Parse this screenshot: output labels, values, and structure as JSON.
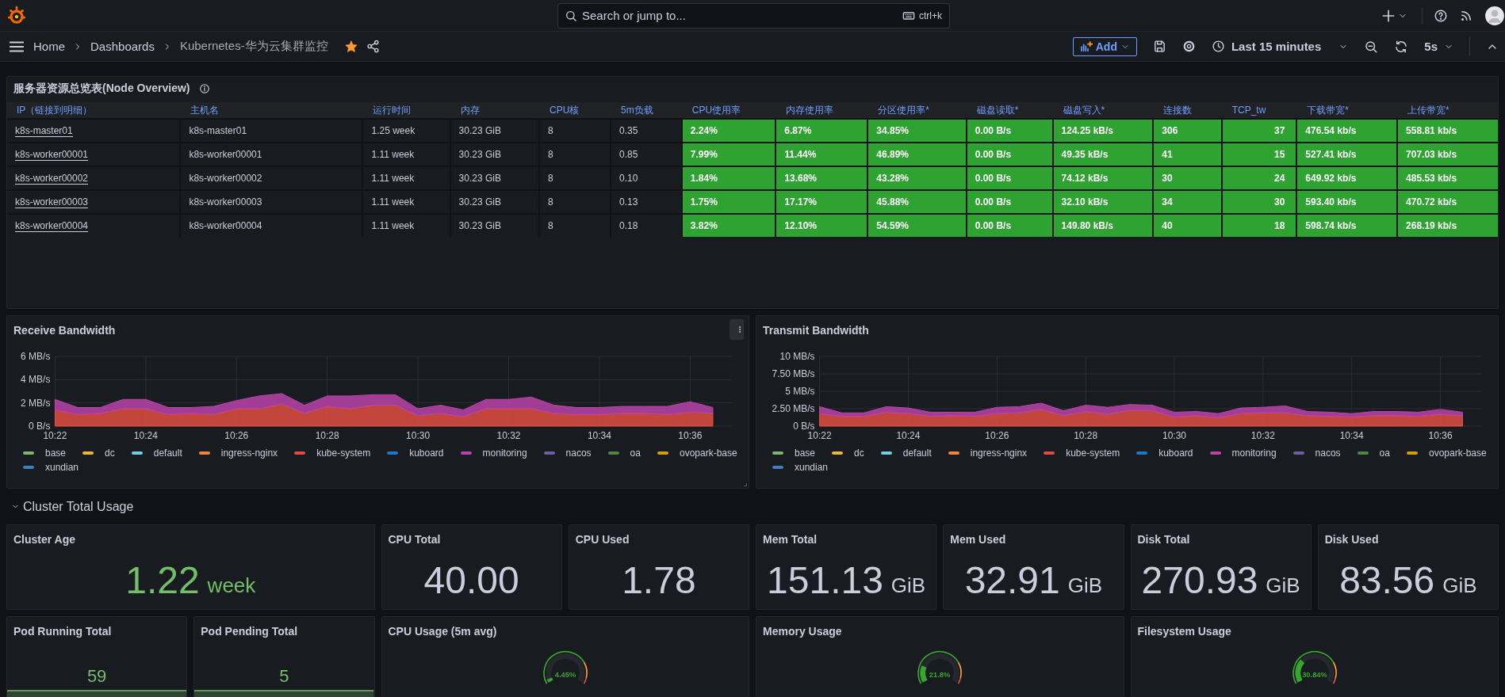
{
  "topbar": {
    "search": {
      "placeholder": "Search or jump to...",
      "shortcut": "ctrl+k"
    }
  },
  "navbar": {
    "breadcrumbs": [
      "Home",
      "Dashboards",
      "Kubernetes-华为云集群监控"
    ],
    "starred": true,
    "add_button": "Add",
    "time_range": "Last 15 minutes",
    "refresh_interval": "5s"
  },
  "table_panel": {
    "title": "服务器资源总览表(Node Overview)",
    "columns": [
      {
        "label": "IP（链接到明细）",
        "kind": "link"
      },
      {
        "label": "主机名",
        "kind": "text"
      },
      {
        "label": "运行时间",
        "kind": "text"
      },
      {
        "label": "内存",
        "kind": "text"
      },
      {
        "label": "CPU核",
        "kind": "text"
      },
      {
        "label": "5m负载",
        "kind": "text"
      },
      {
        "label": "CPU使用率",
        "kind": "colored"
      },
      {
        "label": "内存使用率",
        "kind": "colored"
      },
      {
        "label": "分区使用率*",
        "kind": "colored"
      },
      {
        "label": "磁盘读取*",
        "kind": "colored"
      },
      {
        "label": "磁盘写入*",
        "kind": "colored"
      },
      {
        "label": "连接数",
        "kind": "colored"
      },
      {
        "label": "TCP_tw",
        "kind": "colored-right"
      },
      {
        "label": "下载带宽*",
        "kind": "colored"
      },
      {
        "label": "上传带宽*",
        "kind": "colored"
      }
    ],
    "rows": [
      [
        "k8s-master01",
        "k8s-master01",
        "1.25 week",
        "30.23 GiB",
        "8",
        "0.35",
        "2.24%",
        "6.87%",
        "34.85%",
        "0.00 B/s",
        "124.25 kB/s",
        "306",
        "37",
        "476.54 kb/s",
        "558.81 kb/s"
      ],
      [
        "k8s-worker00001",
        "k8s-worker00001",
        "1.11 week",
        "30.23 GiB",
        "8",
        "0.85",
        "7.99%",
        "11.44%",
        "46.89%",
        "0.00 B/s",
        "49.35 kB/s",
        "41",
        "15",
        "527.41 kb/s",
        "707.03 kb/s"
      ],
      [
        "k8s-worker00002",
        "k8s-worker00002",
        "1.11 week",
        "30.23 GiB",
        "8",
        "0.10",
        "1.84%",
        "13.68%",
        "43.28%",
        "0.00 B/s",
        "74.12 kB/s",
        "30",
        "24",
        "649.92 kb/s",
        "485.53 kb/s"
      ],
      [
        "k8s-worker00003",
        "k8s-worker00003",
        "1.11 week",
        "30.23 GiB",
        "8",
        "0.13",
        "1.75%",
        "17.17%",
        "45.88%",
        "0.00 B/s",
        "32.10 kB/s",
        "34",
        "30",
        "593.40 kb/s",
        "470.72 kb/s"
      ],
      [
        "k8s-worker00004",
        "k8s-worker00004",
        "1.11 week",
        "30.23 GiB",
        "8",
        "0.18",
        "3.82%",
        "12.10%",
        "54.59%",
        "0.00 B/s",
        "149.80 kB/s",
        "40",
        "18",
        "598.74 kb/s",
        "268.19 kb/s"
      ]
    ]
  },
  "charts": [
    {
      "title": "Receive Bandwidth",
      "hovered": true,
      "chart_data": {
        "type": "area",
        "stacked": true,
        "grid": true,
        "categories": [
          "10:22",
          null,
          null,
          null,
          "10:24",
          null,
          null,
          null,
          "10:26",
          null,
          null,
          null,
          "10:28",
          null,
          null,
          null,
          "10:30",
          null,
          null,
          null,
          "10:32",
          null,
          null,
          null,
          "10:34",
          null,
          null,
          null,
          "10:36",
          null
        ],
        "ylim": [
          0,
          6
        ],
        "yticks": [
          {
            "value": 0,
            "label": "0 B/s"
          },
          {
            "value": 2,
            "label": "2 MB/s"
          },
          {
            "value": 4,
            "label": "4 MB/s"
          },
          {
            "value": 6,
            "label": "6 MB/s"
          }
        ],
        "series": [
          {
            "name": "kube-system",
            "color": "#e24d42",
            "values": [
              1.4,
              1.0,
              1.1,
              1.5,
              1.5,
              1.0,
              1.1,
              1.0,
              1.5,
              1.5,
              1.9,
              1.1,
              1.7,
              1.5,
              1.8,
              1.8,
              0.9,
              1.1,
              0.8,
              1.5,
              1.5,
              1.5,
              1.1,
              1.0,
              1.0,
              1.1,
              1.1,
              1.0,
              1.2,
              1.1
            ]
          },
          {
            "name": "monitoring",
            "color": "#ba43a9",
            "values": [
              0.9,
              0.6,
              0.5,
              0.8,
              0.8,
              0.6,
              0.5,
              0.7,
              0.7,
              1.1,
              0.9,
              0.7,
              0.9,
              1.1,
              0.9,
              0.9,
              0.6,
              0.7,
              0.6,
              0.8,
              0.8,
              1.0,
              0.7,
              0.6,
              0.6,
              0.6,
              0.6,
              0.7,
              0.9,
              0.5
            ]
          }
        ]
      },
      "legend": [
        {
          "kind": "flat",
          "name": "base",
          "color": "#7eb26d"
        },
        {
          "kind": "flat",
          "name": "dc",
          "color": "#eab839"
        },
        {
          "kind": "flat",
          "name": "default",
          "color": "#6ed0e0"
        },
        {
          "kind": "flat",
          "name": "ingress-nginx",
          "color": "#ef843c"
        },
        {
          "kind": "series"
        },
        {
          "kind": "flat",
          "name": "kuboard",
          "color": "#1f78c1"
        },
        {
          "kind": "series"
        },
        {
          "kind": "flat",
          "name": "nacos",
          "color": "#705da0"
        },
        {
          "kind": "flat",
          "name": "oa",
          "color": "#508642"
        },
        {
          "kind": "flat",
          "name": "ovopark-base",
          "color": "#cca300"
        },
        {
          "kind": "flat",
          "name": "xundian",
          "color": "#447ebc"
        }
      ]
    },
    {
      "title": "Transmit Bandwidth",
      "hovered": false,
      "chart_data": {
        "type": "area",
        "stacked": true,
        "grid": true,
        "categories": [
          "10:22",
          null,
          null,
          null,
          "10:24",
          null,
          null,
          null,
          "10:26",
          null,
          null,
          null,
          "10:28",
          null,
          null,
          null,
          "10:30",
          null,
          null,
          null,
          "10:32",
          null,
          null,
          null,
          "10:34",
          null,
          null,
          null,
          "10:36",
          null
        ],
        "ylim": [
          0,
          10
        ],
        "yticks": [
          {
            "value": 0,
            "label": "0 B/s"
          },
          {
            "value": 2.5,
            "label": "2.50 MB/s"
          },
          {
            "value": 5,
            "label": "5 MB/s"
          },
          {
            "value": 7.5,
            "label": "7.50 MB/s"
          },
          {
            "value": 10,
            "label": "10 MB/s"
          }
        ],
        "series": [
          {
            "name": "kube-system",
            "color": "#e24d42",
            "values": [
              1.8,
              1.4,
              1.4,
              2.0,
              1.8,
              1.4,
              1.5,
              1.4,
              1.8,
              1.9,
              2.4,
              1.5,
              2.1,
              1.7,
              2.3,
              2.2,
              1.3,
              1.5,
              1.2,
              1.8,
              1.9,
              1.9,
              1.5,
              1.4,
              1.3,
              1.5,
              1.5,
              1.4,
              1.7,
              1.5
            ]
          },
          {
            "name": "monitoring",
            "color": "#ba43a9",
            "values": [
              1.0,
              0.5,
              0.5,
              0.8,
              0.8,
              0.6,
              0.5,
              0.6,
              0.9,
              0.9,
              0.9,
              0.7,
              0.9,
              1.0,
              0.8,
              0.8,
              0.7,
              0.6,
              0.6,
              0.8,
              0.8,
              1.0,
              0.6,
              0.6,
              0.5,
              0.6,
              0.6,
              0.6,
              0.7,
              0.5
            ]
          }
        ]
      },
      "legend": [
        {
          "kind": "flat",
          "name": "base",
          "color": "#7eb26d"
        },
        {
          "kind": "flat",
          "name": "dc",
          "color": "#eab839"
        },
        {
          "kind": "flat",
          "name": "default",
          "color": "#6ed0e0"
        },
        {
          "kind": "flat",
          "name": "ingress-nginx",
          "color": "#ef843c"
        },
        {
          "kind": "series"
        },
        {
          "kind": "flat",
          "name": "kuboard",
          "color": "#1f78c1"
        },
        {
          "kind": "series"
        },
        {
          "kind": "flat",
          "name": "nacos",
          "color": "#705da0"
        },
        {
          "kind": "flat",
          "name": "oa",
          "color": "#508642"
        },
        {
          "kind": "flat",
          "name": "ovopark-base",
          "color": "#cca300"
        },
        {
          "kind": "flat",
          "name": "xundian",
          "color": "#447ebc"
        }
      ]
    }
  ],
  "row_header": {
    "title": "Cluster Total Usage",
    "expanded": true
  },
  "stats": [
    {
      "title": "Cluster Age",
      "value": "1.22",
      "unit": "week",
      "color": "#73bf69"
    },
    {
      "title": "CPU Total",
      "value": "40.00",
      "color": "#ccccdc"
    },
    {
      "title": "CPU Used",
      "value": "1.78",
      "color": "#ccccdc"
    },
    {
      "title": "Mem Total",
      "value": "151.13",
      "unit": "GiB",
      "color": "#ccccdc"
    },
    {
      "title": "Mem Used",
      "value": "32.91",
      "unit": "GiB",
      "color": "#ccccdc"
    },
    {
      "title": "Disk Total",
      "value": "270.93",
      "unit": "GiB",
      "color": "#ccccdc"
    },
    {
      "title": "Disk Used",
      "value": "83.56",
      "unit": "GiB",
      "color": "#ccccdc"
    }
  ],
  "bottom_row": [
    {
      "kind": "sparkline-stat",
      "title": "Pod Running Total",
      "value": "59",
      "color": "#73bf69"
    },
    {
      "kind": "sparkline-stat",
      "title": "Pod Pending Total",
      "value": "5",
      "color": "#73bf69"
    },
    {
      "kind": "gauge",
      "title": "CPU Usage (5m avg)",
      "reading": "4.45%"
    },
    {
      "kind": "gauge",
      "title": "Memory Usage",
      "reading": "21.8%"
    },
    {
      "kind": "gauge",
      "title": "Filesystem Usage",
      "reading": "30.84%"
    }
  ]
}
